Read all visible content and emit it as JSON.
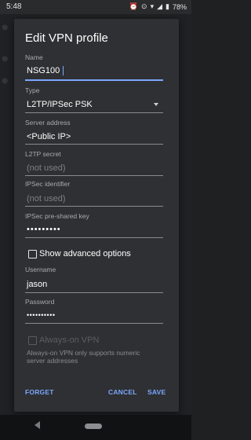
{
  "status_bar": {
    "time": "5:48",
    "battery": "78%",
    "icons": [
      "alarm-icon",
      "vpn-key-icon",
      "wifi-icon",
      "signal-icon",
      "battery-icon"
    ]
  },
  "dialog": {
    "title": "Edit VPN profile",
    "fields": [
      {
        "label": "Name",
        "value": "NSG100",
        "placeholder": "",
        "active": true
      },
      {
        "label": "Type",
        "value": "L2TP/IPSec PSK",
        "placeholder": ""
      },
      {
        "label": "Server address",
        "value": "<Public IP>",
        "placeholder": ""
      },
      {
        "label": "L2TP secret",
        "value": "",
        "placeholder": "(not used)"
      },
      {
        "label": "IPSec identifier",
        "value": "",
        "placeholder": "(not used)"
      },
      {
        "label": "IPSec pre-shared key",
        "value": "•••••••••",
        "placeholder": ""
      },
      {
        "label": "Username",
        "value": "jason",
        "placeholder": ""
      },
      {
        "label": "Password",
        "value": "••••••••••",
        "placeholder": ""
      }
    ],
    "show_advanced_label": "Show advanced options",
    "always_on_label": "Always-on VPN",
    "always_on_note": "Always-on VPN only supports numeric server addresses",
    "actions": {
      "forget": "FORGET",
      "cancel": "CANCEL",
      "save": "SAVE"
    }
  },
  "colors": {
    "dialog_bg": "#2f3033",
    "accent": "#7aa7ff",
    "text_primary": "#ffffff",
    "text_secondary": "#a9aaad"
  }
}
